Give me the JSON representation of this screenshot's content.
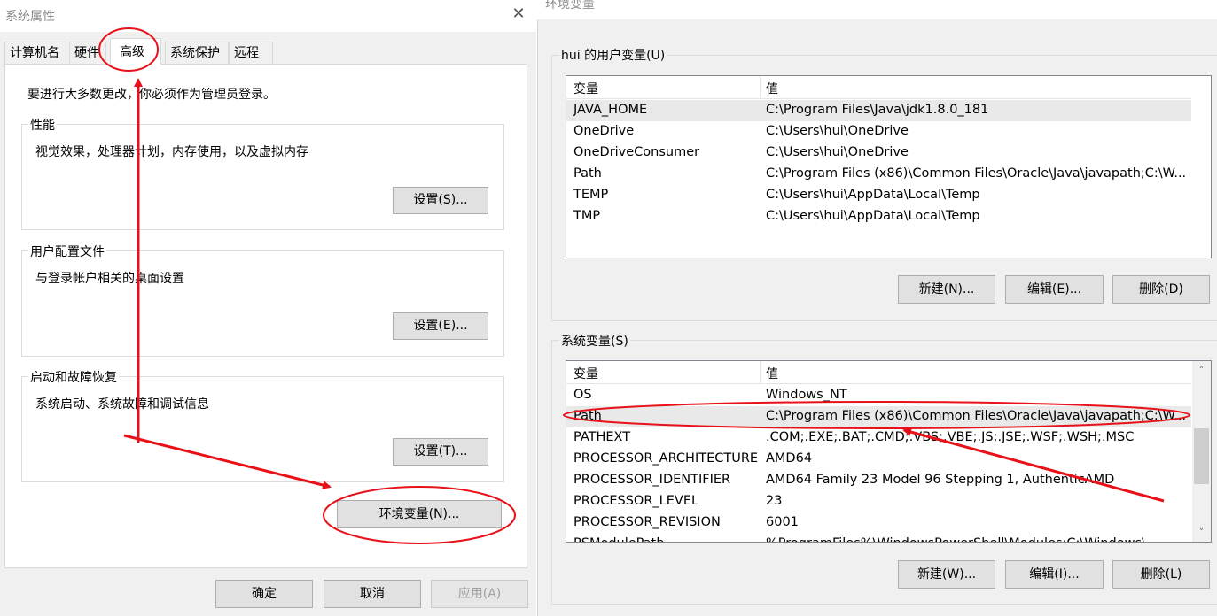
{
  "system_properties": {
    "title": "系统属性",
    "close_glyph": "✕",
    "tabs": [
      {
        "label": "计算机名"
      },
      {
        "label": "硬件"
      },
      {
        "label": "高级"
      },
      {
        "label": "系统保护"
      },
      {
        "label": "远程"
      }
    ],
    "active_tab": "高级",
    "admin_note": "要进行大多数更改，你必须作为管理员登录。",
    "groups": {
      "performance": {
        "label": "性能",
        "desc": "视觉效果，处理器计划，内存使用，以及虚拟内存",
        "button": "设置(S)..."
      },
      "profiles": {
        "label": "用户配置文件",
        "desc": "与登录帐户相关的桌面设置",
        "button": "设置(E)..."
      },
      "startup": {
        "label": "启动和故障恢复",
        "desc": "系统启动、系统故障和调试信息",
        "button": "设置(T)..."
      }
    },
    "env_button": "环境变量(N)...",
    "footer": {
      "ok": "确定",
      "cancel": "取消",
      "apply": "应用(A)"
    }
  },
  "environment_variables": {
    "title": "环境变量",
    "user_section": {
      "label": "hui 的用户变量(U)",
      "columns": [
        "变量",
        "值"
      ],
      "rows": [
        {
          "name": "JAVA_HOME",
          "value": "C:\\Program Files\\Java\\jdk1.8.0_181",
          "selected": true
        },
        {
          "name": "OneDrive",
          "value": "C:\\Users\\hui\\OneDrive"
        },
        {
          "name": "OneDriveConsumer",
          "value": "C:\\Users\\hui\\OneDrive"
        },
        {
          "name": "Path",
          "value": "C:\\Program Files (x86)\\Common Files\\Oracle\\Java\\javapath;C:\\W..."
        },
        {
          "name": "TEMP",
          "value": "C:\\Users\\hui\\AppData\\Local\\Temp"
        },
        {
          "name": "TMP",
          "value": "C:\\Users\\hui\\AppData\\Local\\Temp"
        }
      ],
      "buttons": {
        "new": "新建(N)...",
        "edit": "编辑(E)...",
        "delete": "删除(D)"
      }
    },
    "system_section": {
      "label": "系统变量(S)",
      "columns": [
        "变量",
        "值"
      ],
      "rows": [
        {
          "name": "OS",
          "value": "Windows_NT"
        },
        {
          "name": "Path",
          "value": "C:\\Program Files (x86)\\Common Files\\Oracle\\Java\\javapath;C:\\W...",
          "selected": true
        },
        {
          "name": "PATHEXT",
          "value": ".COM;.EXE;.BAT;.CMD;.VBS;.VBE;.JS;.JSE;.WSF;.WSH;.MSC"
        },
        {
          "name": "PROCESSOR_ARCHITECTURE",
          "value": "AMD64"
        },
        {
          "name": "PROCESSOR_IDENTIFIER",
          "value": "AMD64 Family 23 Model 96 Stepping 1, AuthenticAMD"
        },
        {
          "name": "PROCESSOR_LEVEL",
          "value": "23"
        },
        {
          "name": "PROCESSOR_REVISION",
          "value": "6001"
        },
        {
          "name": "PSModulePath",
          "value": "%ProgramFiles%\\WindowsPowerShell\\Modules;C:\\Windows\\..."
        }
      ],
      "scroll_up_glyph": "˄",
      "scroll_down_glyph": "˅",
      "buttons": {
        "new": "新建(W)...",
        "edit": "编辑(I)...",
        "delete": "删除(L)"
      }
    }
  },
  "colors": {
    "annotation": "#e8111a",
    "dialog_bg": "#f0f0f0",
    "selection": "#e9e9e9"
  }
}
